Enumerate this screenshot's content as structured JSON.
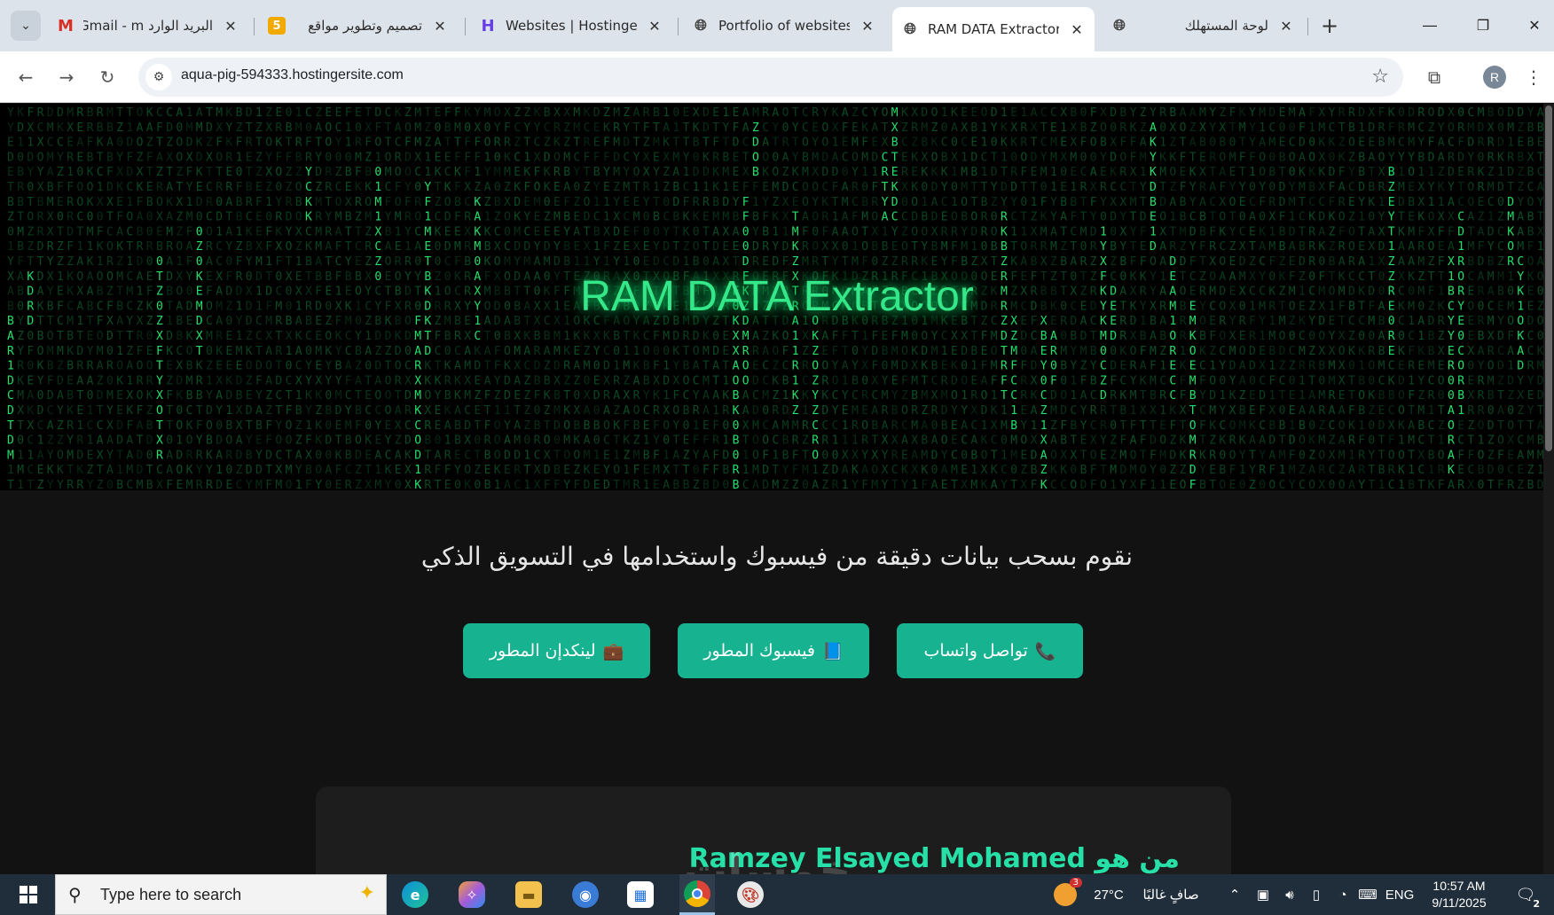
{
  "browser": {
    "tabs": [
      {
        "title": "البريد الوارد Gmail - m",
        "favicon": "gmail-icon",
        "rtl": true
      },
      {
        "title": "تصميم وتطوير مواقع",
        "favicon": "khamsat-icon",
        "favicon_text": "5",
        "rtl": true
      },
      {
        "title": "Websites | Hostinger",
        "favicon": "hostinger-icon",
        "rtl": false
      },
      {
        "title": "Portfolio of websites",
        "favicon": "globe-icon",
        "rtl": false
      },
      {
        "title": "RAM DATA Extractor",
        "favicon": "globe-icon",
        "rtl": false,
        "active": true
      },
      {
        "title": "لوحة المستهلك",
        "favicon": "globe-icon",
        "rtl": true
      }
    ],
    "url": "aqua-pig-594333.hostingersite.com",
    "profile_initial": "R"
  },
  "page": {
    "hero_title": "RAM DATA Extractor",
    "tagline": "نقوم بسحب بيانات دقيقة من فيسبوك واستخدامها في التسويق الذكي",
    "buttons": {
      "whatsapp": {
        "label": "تواصل واتساب",
        "icon": "📞"
      },
      "facebook": {
        "label": "فيسبوك المطور",
        "icon": "📘"
      },
      "linkedin": {
        "label": "لينكدإن المطور",
        "icon": "💼"
      }
    },
    "about_title": "من هو Ramzey Elsayed Mohamed",
    "watermark": "خمسات",
    "matrix_colors": {
      "bright": "#22e06a",
      "dim": "#0f6b34"
    }
  },
  "taskbar": {
    "search_placeholder": "Type here to search",
    "weather_temp": "27°C",
    "weather_text": "صافٍ غالبًا",
    "weather_badge": "3",
    "lang": "ENG",
    "time": "10:57 AM",
    "date": "9/11/2025",
    "notif_count": "2"
  }
}
